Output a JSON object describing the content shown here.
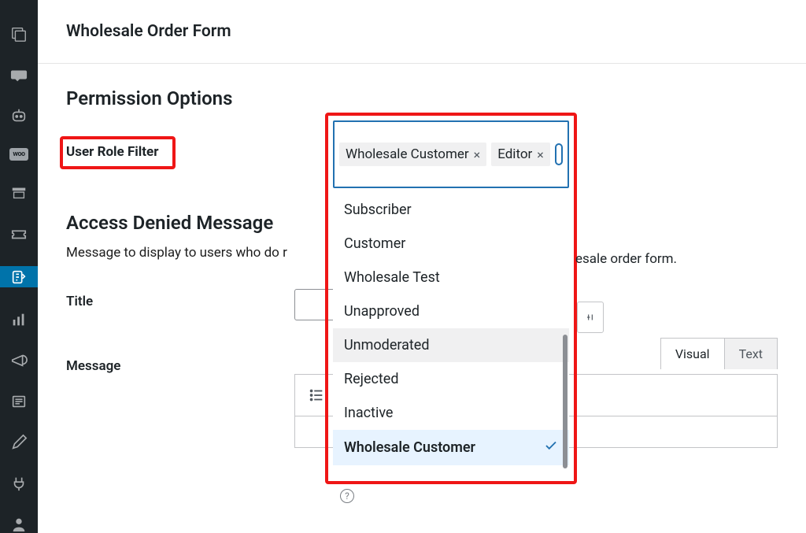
{
  "page_title": "Wholesale Order Form",
  "sections": {
    "permission_heading": "Permission Options",
    "user_role_filter_label": "User Role Filter",
    "access_denied_heading": "Access Denied Message",
    "access_denied_desc_left": "Message to display to users who do r",
    "access_denied_desc_right": "esale order form.",
    "title_label": "Title",
    "message_label": "Message"
  },
  "role_filter": {
    "selected": [
      {
        "label": "Wholesale Customer"
      },
      {
        "label": "Editor"
      }
    ],
    "options": [
      {
        "label": "Subscriber",
        "state": "normal"
      },
      {
        "label": "Customer",
        "state": "normal"
      },
      {
        "label": "Wholesale Test",
        "state": "normal"
      },
      {
        "label": "Unapproved",
        "state": "normal"
      },
      {
        "label": "Unmoderated",
        "state": "hover"
      },
      {
        "label": "Rejected",
        "state": "normal"
      },
      {
        "label": "Inactive",
        "state": "normal"
      },
      {
        "label": "Wholesale Customer",
        "state": "selected"
      }
    ]
  },
  "editor": {
    "tabs": {
      "visual": "Visual",
      "text": "Text"
    }
  },
  "sidebar_woo_label": "woo"
}
